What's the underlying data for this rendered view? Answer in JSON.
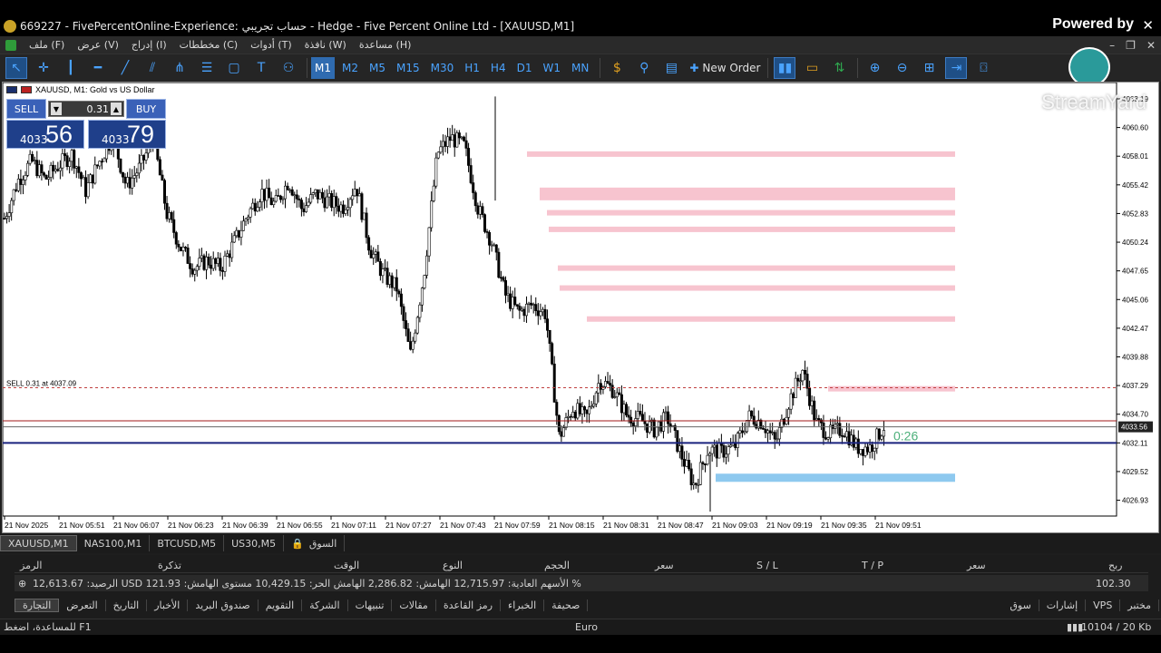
{
  "title": "669227 - FivePercentOnline-Experience: حساب تجريبي - Hedge - Five Percent Online Ltd - [XAUUSD,M1]",
  "powered_by": "Powered by",
  "watermark": "StreamYard",
  "menu": [
    "ملف (F)",
    "عرض (V)",
    "إدراج (I)",
    "مخططات (C)",
    "أدوات (T)",
    "نافذة (W)",
    "مساعدة (H)"
  ],
  "timeframes": [
    "M1",
    "M2",
    "M5",
    "M15",
    "M30",
    "H1",
    "H4",
    "D1",
    "W1",
    "MN"
  ],
  "active_timeframe": "M1",
  "new_order": "New Order",
  "chart": {
    "symbol_title": "XAUUSD, M1:  Gold vs US Dollar",
    "sell_label": "SELL",
    "buy_label": "BUY",
    "lot": "0.31",
    "sell_small": "4033",
    "sell_big": "56",
    "buy_small": "4033",
    "buy_big": "79",
    "position_label": "SELL 0.31 at 4037.09",
    "countdown": "0:26",
    "current_price": "4033.56",
    "price_labels": [
      "4063.19",
      "4060.60",
      "4058.01",
      "4055.42",
      "4052.83",
      "4050.24",
      "4047.65",
      "4045.06",
      "4042.47",
      "4039.88",
      "4037.29",
      "4034.70",
      "4032.11",
      "4029.52",
      "4026.93"
    ],
    "time_labels": [
      "21 Nov 2025",
      "21 Nov 05:51",
      "21 Nov 06:07",
      "21 Nov 06:23",
      "21 Nov 06:39",
      "21 Nov 06:55",
      "21 Nov 07:11",
      "21 Nov 07:27",
      "21 Nov 07:43",
      "21 Nov 07:59",
      "21 Nov 08:15",
      "21 Nov 08:31",
      "21 Nov 08:47",
      "21 Nov 09:03",
      "21 Nov 09:19",
      "21 Nov 09:35",
      "21 Nov 09:51"
    ]
  },
  "chart_data": {
    "type": "candlestick",
    "symbol": "XAUUSD",
    "timeframe": "M1",
    "ylim": [
      4025.5,
      4064.5
    ],
    "close_path": [
      4052.4,
      4055.8,
      4057.6,
      4055.9,
      4057.2,
      4058.2,
      4054.9,
      4057.5,
      4059.8,
      4055.3,
      4057.0,
      4059.6,
      4052.8,
      4049.8,
      4047.9,
      4048.6,
      4047.9,
      4050.3,
      4052.8,
      4054.8,
      4053.6,
      4055.8,
      4053.2,
      4054.6,
      4053.9,
      4053.4,
      4055.4,
      4049.7,
      4047.3,
      4046.1,
      4040.0,
      4047.3,
      4058.3,
      4059.7,
      4058.9,
      4053.3,
      4050.3,
      4045.5,
      4043.9,
      4044.6,
      4043.8,
      4032.6,
      4035.3,
      4034.3,
      4037.8,
      4036.9,
      4034.6,
      4034.2,
      4033.3,
      4034.4,
      4031.1,
      4028.2,
      4031.5,
      4031.3,
      4031.8,
      4034.5,
      4034.0,
      4032.1,
      4035.9,
      4038.7,
      4033.9,
      4032.9,
      4033.4,
      4031.7,
      4031.7,
      4033.6
    ],
    "levels": {
      "sell_position": 4037.09,
      "bid": 4033.56,
      "red_line": 4034.1,
      "blue_line": 4032.11
    },
    "zones_pink": [
      4058.2,
      4054.6,
      4052.9,
      4051.4,
      4047.9,
      4046.1,
      4043.3,
      4037.0
    ],
    "zone_blue": 4029.0
  },
  "terminal": {
    "headers": [
      "الرمز",
      "تذكرة",
      "الوقت",
      "النوع",
      "الحجم",
      "سعر",
      "S / L",
      "T / P",
      "سعر",
      "ربح"
    ],
    "summary": "الرصيد: 12,613.67 USD  الأسهم العادية: 12,715.97  الهامش: 2,286.82  الهامش الحر: 10,429.15  مستوى الهامش: 121.93 %",
    "profit": "102.30",
    "tabs": [
      "التجارة",
      "التعرض",
      "التاريخ",
      "الأخبار",
      "صندوق البريد",
      "التقويم",
      "الشركة",
      "تنبيهات",
      "مقالات",
      "رمز القاعدة",
      "الخبراء",
      "صحيفة"
    ],
    "right_tabs": [
      "سوق",
      "إشارات",
      "VPS",
      "مختبر"
    ]
  },
  "symbol_tabs": [
    "XAUUSD,M1",
    "NAS100,M1",
    "BTCUSD,M5",
    "US30,M5",
    "السوق"
  ],
  "status": {
    "help": "للمساعدة، اضغط F1",
    "profile": "Euro",
    "traffic": "10104 / 20 Kb"
  },
  "colors": {
    "bull": "#000000",
    "bear": "#000000",
    "pink_zone": "#f7c4cf",
    "blue_zone": "#8ec9ef",
    "bid_line": "#a01818",
    "blue_line": "#1a237e"
  }
}
